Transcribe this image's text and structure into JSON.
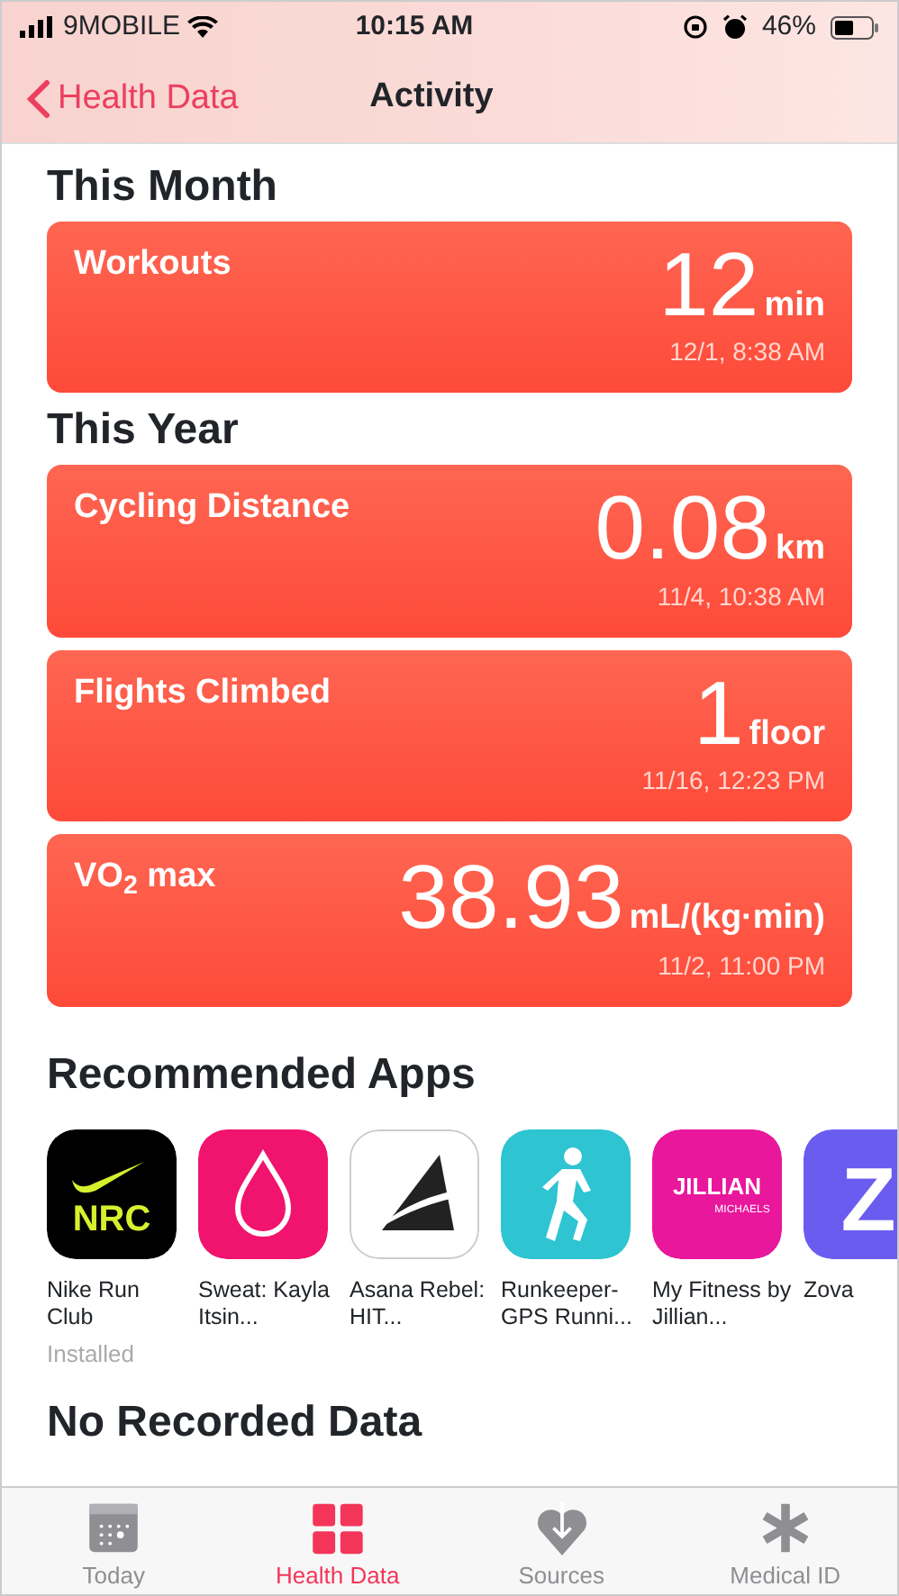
{
  "status_bar": {
    "carrier": "9MOBILE",
    "time": "10:15 AM",
    "battery": "46%"
  },
  "nav": {
    "back": "Health Data",
    "title": "Activity"
  },
  "sections": [
    {
      "title": "This Month",
      "cards": [
        {
          "label": "Workouts",
          "value": "12",
          "unit": "min",
          "date": "12/1, 8:38 AM"
        }
      ]
    },
    {
      "title": "This Year",
      "cards": [
        {
          "label": "Cycling Distance",
          "value": "0.08",
          "unit": "km",
          "date": "11/4, 10:38 AM"
        },
        {
          "label": "Flights Climbed",
          "value": "1",
          "unit": "floor",
          "date": "11/16, 12:23 PM"
        },
        {
          "label": "VO$_{2}$ max",
          "value": "38.93",
          "unit": "mL/(kg·min)",
          "date": "11/2, 11:00 PM"
        }
      ]
    }
  ],
  "recommended": {
    "title": "Recommended Apps",
    "apps": [
      {
        "kind": "nrc",
        "logo_text": [
          "NRC"
        ],
        "name": "Nike Run Club",
        "status": "Installed"
      },
      {
        "kind": "drop",
        "name": "Sweat: Kayla Itsin..."
      },
      {
        "kind": "triangle",
        "name": "Asana Rebel: HIT..."
      },
      {
        "kind": "runner",
        "name": "Runkeeper-GPS Runni..."
      },
      {
        "kind": "jillian",
        "logo_text": [
          "JILLIAN",
          "MICHAELS"
        ],
        "name": "My Fitness by Jillian..."
      },
      {
        "kind": "zova",
        "logo_text": [
          "Z"
        ],
        "name": "Zova"
      }
    ]
  },
  "next_section": "No Recorded Data",
  "tabs": [
    {
      "kind": "today",
      "label": "Today",
      "selected": false
    },
    {
      "kind": "health",
      "label": "Health Data",
      "selected": true
    },
    {
      "kind": "sources",
      "label": "Sources",
      "selected": false
    },
    {
      "kind": "medical",
      "label": "Medical ID",
      "selected": false
    }
  ]
}
